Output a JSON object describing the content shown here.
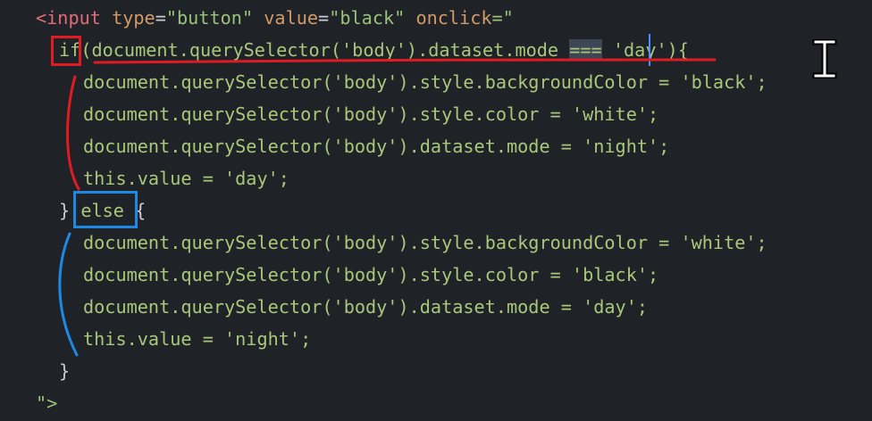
{
  "lines": {
    "l1": {
      "open": "<input",
      "type_attr": "type",
      "type_val": "\"button\"",
      "value_attr": "value",
      "value_val": "\"black\"",
      "onclick_attr": "onclick",
      "onclick_open": "=\""
    },
    "l2": {
      "kw": "if",
      "cond_a": "(document.querySelector('body').dataset.mode ",
      "op": "===",
      "cond_b": " 'day'){"
    },
    "l3": "document.querySelector('body').style.backgroundColor = 'black';",
    "l4": "document.querySelector('body').style.color = 'white';",
    "l5": "document.querySelector('body').dataset.mode = 'night';",
    "l6": "this.value = 'day';",
    "l7": {
      "close": "}",
      "kw": "else",
      "open": "{"
    },
    "l8": "document.querySelector('body').style.backgroundColor = 'white';",
    "l9": "document.querySelector('body').style.color = 'black';",
    "l10": "document.querySelector('body').dataset.mode = 'day';",
    "l11": "this.value = 'night';",
    "l12": "}",
    "l13": "\">"
  },
  "colors": {
    "background": "#1f2227",
    "tag": "#e06c75",
    "attribute": "#d19a66",
    "string": "#98c379",
    "annotation_red": "#e01b24",
    "annotation_blue": "#1e88e5",
    "cursor": "#528bff"
  },
  "icons": {
    "pointer": "text-cursor-ibeam-icon"
  }
}
